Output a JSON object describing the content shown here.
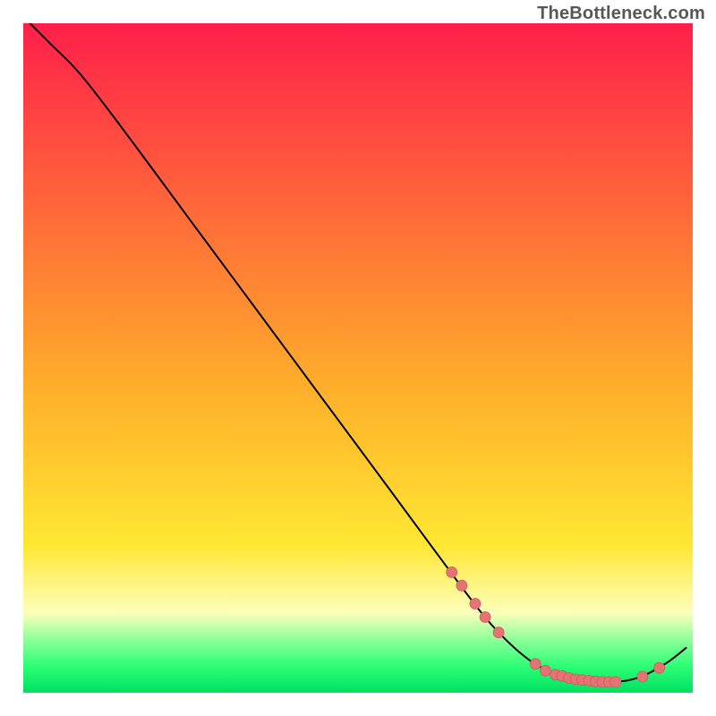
{
  "watermark": "TheBottleneck.com",
  "colors": {
    "gradient_top": "#ff1f4a",
    "gradient_yellow": "#ffd632",
    "gradient_pale": "#fcffba",
    "gradient_green_top": "#8fff9a",
    "gradient_green_mid": "#2dff76",
    "gradient_green_bottom": "#00e060",
    "curve": "#000000",
    "marker_fill": "#e57373",
    "marker_stroke": "#cc5b5b"
  },
  "chart_data": {
    "type": "line",
    "title": "",
    "xlabel": "",
    "ylabel": "",
    "xlim": [
      0,
      100
    ],
    "ylim": [
      0,
      100
    ],
    "note": "Axes are unlabeled in the source image; values are read proportionally from pixel positions within the plot area (0–100 each axis, y increases upward).",
    "series": [
      {
        "name": "curve",
        "points": [
          {
            "x": 1.0,
            "y": 100.0
          },
          {
            "x": 4.0,
            "y": 97.0
          },
          {
            "x": 8.0,
            "y": 93.0
          },
          {
            "x": 12.0,
            "y": 88.0
          },
          {
            "x": 18.0,
            "y": 80.0
          },
          {
            "x": 25.0,
            "y": 70.5
          },
          {
            "x": 35.0,
            "y": 57.0
          },
          {
            "x": 45.0,
            "y": 43.5
          },
          {
            "x": 55.0,
            "y": 30.0
          },
          {
            "x": 62.0,
            "y": 20.5
          },
          {
            "x": 68.0,
            "y": 12.5
          },
          {
            "x": 72.0,
            "y": 8.0
          },
          {
            "x": 76.0,
            "y": 4.6
          },
          {
            "x": 80.0,
            "y": 2.6
          },
          {
            "x": 84.0,
            "y": 1.8
          },
          {
            "x": 88.0,
            "y": 1.6
          },
          {
            "x": 92.0,
            "y": 2.3
          },
          {
            "x": 96.0,
            "y": 4.4
          },
          {
            "x": 99.0,
            "y": 6.7
          }
        ]
      }
    ],
    "markers": {
      "name": "highlighted-points",
      "radius_px": 6,
      "points": [
        {
          "x": 64.0,
          "y": 18.0
        },
        {
          "x": 65.5,
          "y": 16.0
        },
        {
          "x": 67.5,
          "y": 13.3
        },
        {
          "x": 69.0,
          "y": 11.3
        },
        {
          "x": 71.0,
          "y": 9.0
        },
        {
          "x": 76.5,
          "y": 4.3
        },
        {
          "x": 78.0,
          "y": 3.3
        },
        {
          "x": 79.5,
          "y": 2.7
        },
        {
          "x": 80.5,
          "y": 2.5
        },
        {
          "x": 81.5,
          "y": 2.2
        },
        {
          "x": 82.5,
          "y": 2.0
        },
        {
          "x": 83.5,
          "y": 1.9
        },
        {
          "x": 84.5,
          "y": 1.8
        },
        {
          "x": 85.5,
          "y": 1.7
        },
        {
          "x": 86.5,
          "y": 1.6
        },
        {
          "x": 87.5,
          "y": 1.6
        },
        {
          "x": 88.5,
          "y": 1.6
        },
        {
          "x": 92.5,
          "y": 2.4
        },
        {
          "x": 95.0,
          "y": 3.7
        }
      ]
    }
  }
}
